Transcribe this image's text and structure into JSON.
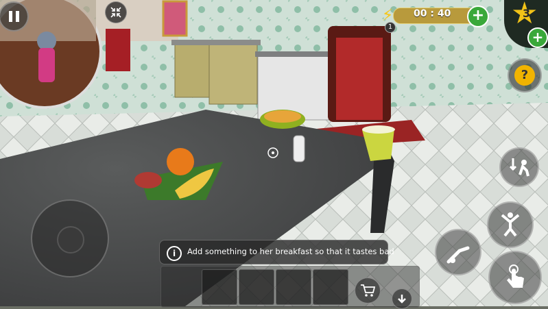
{
  "hud": {
    "pause_icon": "pause-icon",
    "collapse_icon": "collapse-arrows-icon",
    "energy_icon": "lightning-icon",
    "energy_count": "1",
    "timer": "00 : 40",
    "add_time_icon": "plus-icon",
    "stars_count": "3",
    "add_stars_icon": "plus-icon",
    "hint_label": "?"
  },
  "objective": {
    "info_icon": "i",
    "text": "Add something to her breakfast so that it tastes bad"
  },
  "actions": {
    "crouch_icon": "crouch-icon",
    "jump_icon": "jump-icon",
    "throw_icon": "throw-icon",
    "interact_icon": "hand-tap-icon",
    "cart_icon": "cart-icon",
    "drop_icon": "down-arrow-icon"
  },
  "inventory": {
    "slots": [
      "",
      "",
      "",
      ""
    ]
  },
  "colors": {
    "timer_bg": "#b89a3c",
    "green_plus": "#3aa83a",
    "star": "#f2c318",
    "hint": "#f0b400"
  }
}
